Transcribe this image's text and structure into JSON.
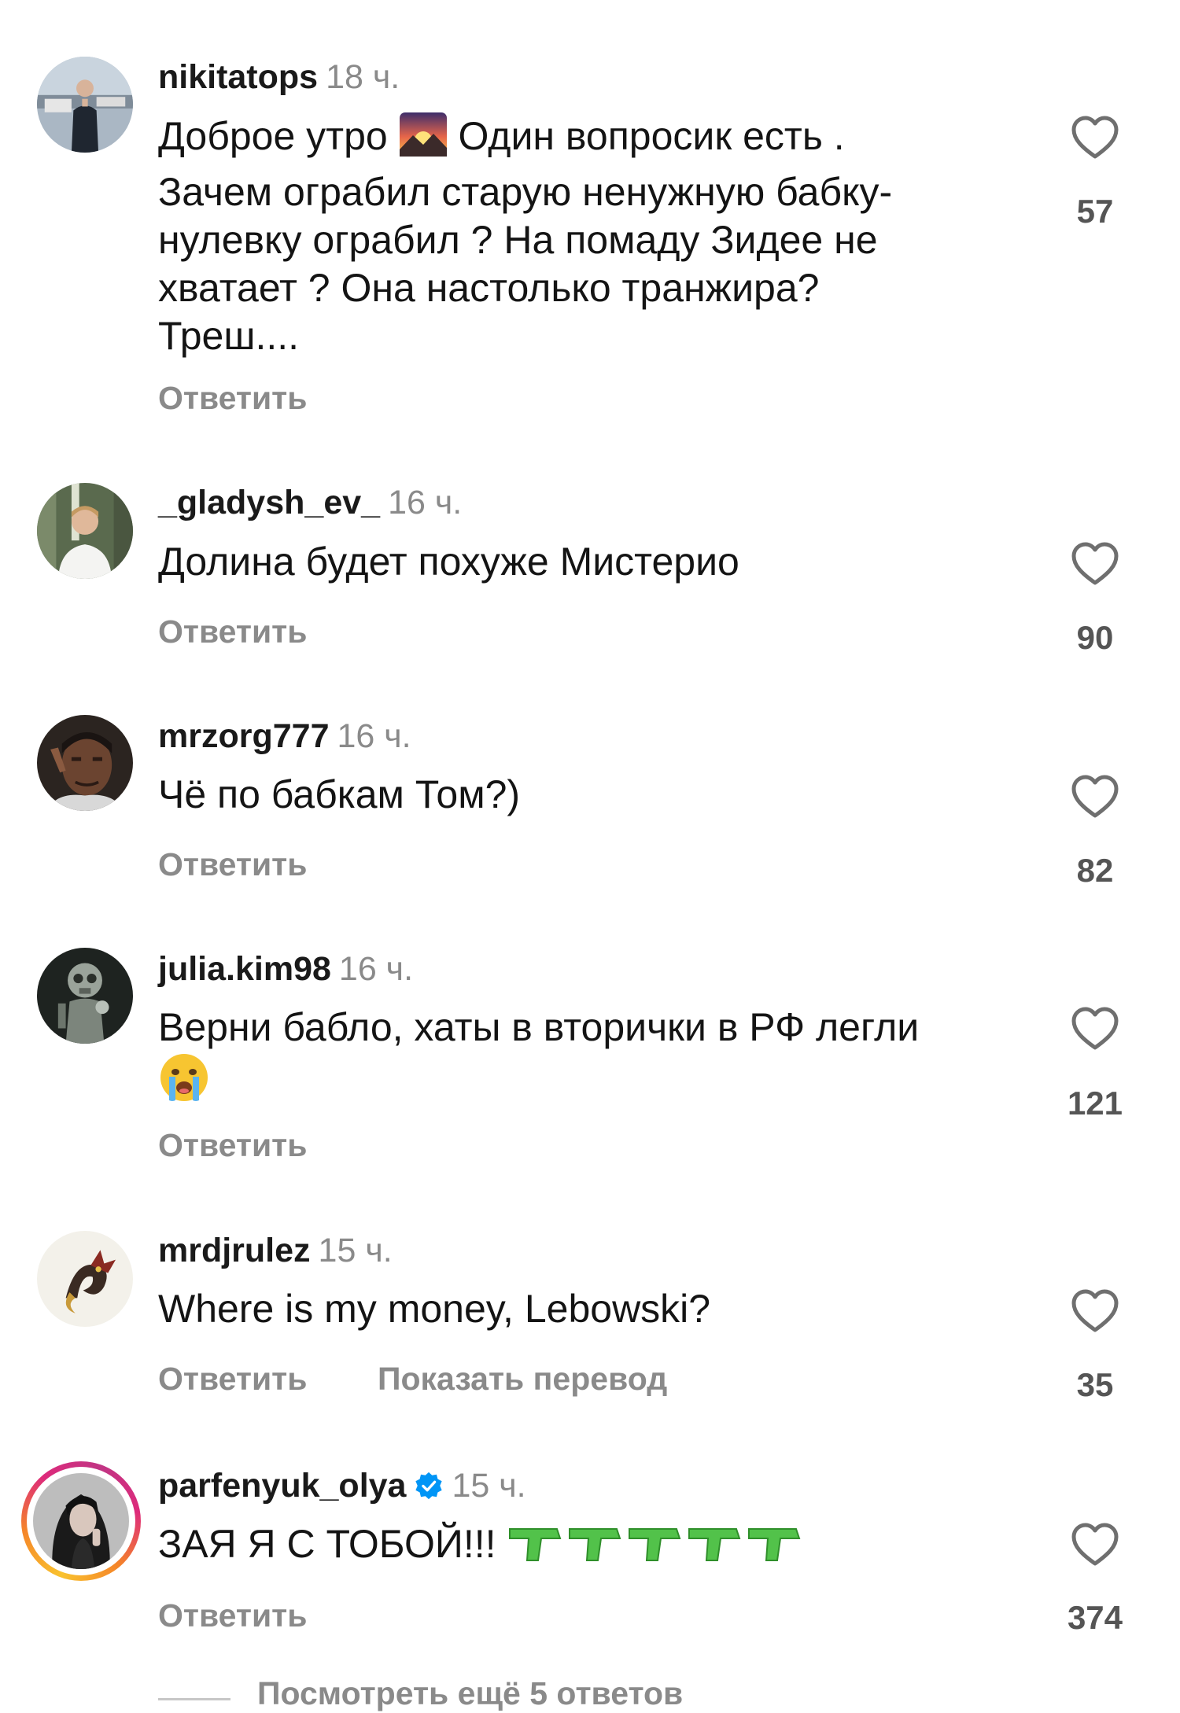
{
  "comments": [
    {
      "username": "nikitatops",
      "time": "18 ч.",
      "text_lines": [
        "Доброе утро",
        "Один вопросик есть .",
        "Зачем ограбил старую ненужную  бабку-",
        "нулевку ограбил ? На помаду Зидее не",
        "хватает ? Она настолько транжира?",
        "Треш...."
      ],
      "reply": "Ответить",
      "likes": "57",
      "avatar_icon": "profile-photo-man-on-boat"
    },
    {
      "username": "_gladysh_ev_",
      "time": "16 ч.",
      "text": "Долина будет похуже Мистерио",
      "reply": "Ответить",
      "likes": "90",
      "avatar_icon": "profile-photo-young-man"
    },
    {
      "username": "mrzorg777",
      "time": "16 ч.",
      "text": "Чё по бабкам Том?)",
      "reply": "Ответить",
      "likes": "82",
      "avatar_icon": "profile-photo-man-pointing-head"
    },
    {
      "username": "julia.kim98",
      "time": "16 ч.",
      "text": "Верни бабло, хаты в вторички в РФ легли",
      "reply": "Ответить",
      "likes": "121",
      "avatar_icon": "profile-photo-robot-figure",
      "emoji_icon": "crying-face-emoji"
    },
    {
      "username": "mrdjrulez",
      "time": "15 ч.",
      "text": "Where is my money, Lebowski?",
      "reply": "Ответить",
      "translate": "Показать перевод",
      "likes": "35",
      "avatar_icon": "profile-photo-dragon-logo"
    },
    {
      "username": "parfenyuk_olya",
      "time": "15 ч.",
      "text": "ЗАЯ Я С ТОБОЙ!!!",
      "reply": "Ответить",
      "likes": "374",
      "verified": true,
      "avatar_icon": "profile-photo-woman-with-story-ring",
      "emoji_icon": "water-pistol-emoji"
    }
  ],
  "view_more_replies": "Посмотреть ещё 5 ответов",
  "colors": {
    "text": "#141414",
    "muted": "#8a8a8a",
    "verified": "#0095f6",
    "pistol": "#52c24a"
  }
}
